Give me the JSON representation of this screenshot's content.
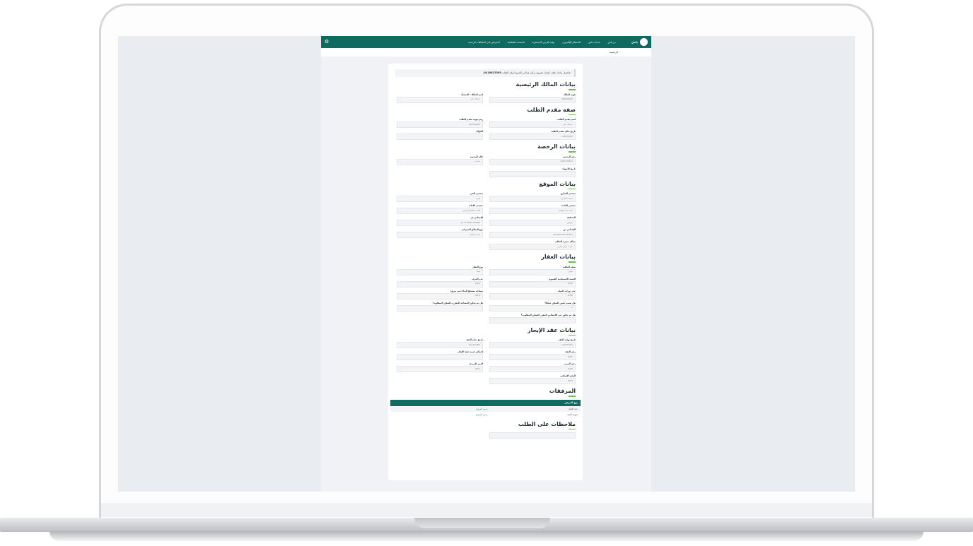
{
  "nav": {
    "logo_text": "بلدي",
    "items": [
      "من بلدي",
      "خدمات بلدي",
      "الاستعلام الإلكتروني",
      "بوابة الفرص الاستثمارية",
      "المنصات القطاعية",
      "الاعتراض على المخالفات الرصدية"
    ],
    "gear": "⚙"
  },
  "breadcrumb": "الرئيسية",
  "request_header": {
    "text": "تفاصيل بيانات طلب إصدار تصريح سكن عمالي (للنمو) (رقم الطلب ",
    "number": "4416823369",
    "suffix": ")"
  },
  "sections": {
    "owner": {
      "title": "بيانات المالك الرئيسية",
      "fields": [
        {
          "label": "هوية المالك",
          "value": "000000000"
        },
        {
          "label": "اسم المالك / المنشأة",
          "value": "عبدالله علي"
        }
      ]
    },
    "applicant": {
      "title": "صفة مقدم الطلب",
      "fields": [
        {
          "label": "اسم مقدم الطلب",
          "value": "عبدالله علي"
        },
        {
          "label": "رقم هوية مقدم الطلب",
          "value": "000000000"
        },
        {
          "label": "تاريخ ميلاد مقدم الطلب",
          "value": "1399/00/00"
        },
        {
          "label": "الجوال",
          "value": ""
        }
      ]
    },
    "license": {
      "title": "بيانات الرخصة",
      "fields": [
        {
          "label": "رقم الرخصة",
          "value": "4401232453"
        },
        {
          "label": "حالة الرخصة",
          "value": "سارية"
        },
        {
          "label": "تاريخ الانتهاء",
          "value": ""
        }
      ]
    },
    "location": {
      "title": "بيانات الموقع",
      "fields": [
        {
          "label": "مسمى الشارع",
          "value": "محمد العثماني"
        },
        {
          "label": "مسمى الحي",
          "value": "الحي"
        },
        {
          "label": "مسمى البلدية",
          "value": "بلدية جدة الوطنية"
        },
        {
          "label": "مسمى الأمانة",
          "value": "أمانة محافظة الرياض"
        },
        {
          "label": "المنطقة",
          "value": "الرياض"
        },
        {
          "label": "الإحداثي س",
          "value": "24.7744045169868"
        },
        {
          "label": "الإحداثي ص",
          "value": "46.6444512787852"
        },
        {
          "label": "نوع النطاق العمراني",
          "value": "داخل النطاق"
        },
        {
          "label": "معالم مميزة للمكان",
          "value": "بجانب مركز تجاري"
        }
      ]
    },
    "property": {
      "title": "بيانات العقار",
      "fields": [
        {
          "label": "صفة الملكية",
          "value": "مؤجر"
        },
        {
          "label": "نوع العقار",
          "value": "شقة"
        },
        {
          "label": "السعة الاستيعابية القصوى",
          "value": "### "
        },
        {
          "label": "عدد الغرف",
          "value": "###"
        },
        {
          "label": "عدد دورات المياه",
          "value": "###"
        },
        {
          "label": "مساحة مسطح البناء (متر مربع)",
          "value": "###"
        },
        {
          "label": "هل سيتم تأمين السكن عمليًا؟",
          "value": "لا"
        },
        {
          "label": "هل تم تجاوز المساحة المقررة للسكن المطلوب؟",
          "value": ""
        },
        {
          "label": "هل تم تجاوز عدد الأشخاص المقرر للسكن المطلوب؟",
          "value": ""
        }
      ]
    },
    "lease": {
      "title": "بيانات عقد الإيجار",
      "fields": [
        {
          "label": "تاريخ نهاية العقد",
          "value": "1444/00/00"
        },
        {
          "label": "تاريخ بداية العقد",
          "value": "1444/00/00"
        },
        {
          "label": "رقم العقد",
          "value": "###"
        },
        {
          "label": "إجمالي قيمة عقد الإيجار",
          "value": ""
        },
        {
          "label": "رقم المبنى",
          "value": "###"
        },
        {
          "label": "الرمز البريدي",
          "value": "###"
        },
        {
          "label": "الرقم الإضافي",
          "value": "###"
        }
      ]
    },
    "attachments": {
      "title": "المرفقات",
      "header": "نوع المرفق",
      "rows": [
        {
          "name": "عقد الإيجار",
          "link": "عرض المرفق"
        },
        {
          "name": "صورة الصك",
          "link": "عرض المرفق"
        }
      ]
    },
    "notes": {
      "title": "ملاحظات على الطلب"
    }
  }
}
